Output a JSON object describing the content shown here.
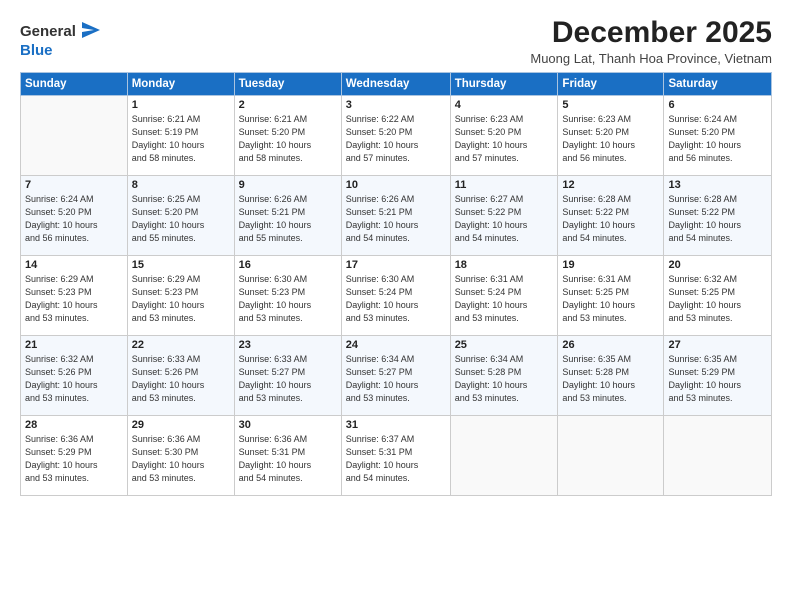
{
  "logo": {
    "general": "General",
    "blue": "Blue"
  },
  "header": {
    "month_year": "December 2025",
    "location": "Muong Lat, Thanh Hoa Province, Vietnam"
  },
  "days_of_week": [
    "Sunday",
    "Monday",
    "Tuesday",
    "Wednesday",
    "Thursday",
    "Friday",
    "Saturday"
  ],
  "weeks": [
    [
      {
        "day": "",
        "info": ""
      },
      {
        "day": "1",
        "info": "Sunrise: 6:21 AM\nSunset: 5:19 PM\nDaylight: 10 hours\nand 58 minutes."
      },
      {
        "day": "2",
        "info": "Sunrise: 6:21 AM\nSunset: 5:20 PM\nDaylight: 10 hours\nand 58 minutes."
      },
      {
        "day": "3",
        "info": "Sunrise: 6:22 AM\nSunset: 5:20 PM\nDaylight: 10 hours\nand 57 minutes."
      },
      {
        "day": "4",
        "info": "Sunrise: 6:23 AM\nSunset: 5:20 PM\nDaylight: 10 hours\nand 57 minutes."
      },
      {
        "day": "5",
        "info": "Sunrise: 6:23 AM\nSunset: 5:20 PM\nDaylight: 10 hours\nand 56 minutes."
      },
      {
        "day": "6",
        "info": "Sunrise: 6:24 AM\nSunset: 5:20 PM\nDaylight: 10 hours\nand 56 minutes."
      }
    ],
    [
      {
        "day": "7",
        "info": "Sunrise: 6:24 AM\nSunset: 5:20 PM\nDaylight: 10 hours\nand 56 minutes."
      },
      {
        "day": "8",
        "info": "Sunrise: 6:25 AM\nSunset: 5:20 PM\nDaylight: 10 hours\nand 55 minutes."
      },
      {
        "day": "9",
        "info": "Sunrise: 6:26 AM\nSunset: 5:21 PM\nDaylight: 10 hours\nand 55 minutes."
      },
      {
        "day": "10",
        "info": "Sunrise: 6:26 AM\nSunset: 5:21 PM\nDaylight: 10 hours\nand 54 minutes."
      },
      {
        "day": "11",
        "info": "Sunrise: 6:27 AM\nSunset: 5:22 PM\nDaylight: 10 hours\nand 54 minutes."
      },
      {
        "day": "12",
        "info": "Sunrise: 6:28 AM\nSunset: 5:22 PM\nDaylight: 10 hours\nand 54 minutes."
      },
      {
        "day": "13",
        "info": "Sunrise: 6:28 AM\nSunset: 5:22 PM\nDaylight: 10 hours\nand 54 minutes."
      }
    ],
    [
      {
        "day": "14",
        "info": "Sunrise: 6:29 AM\nSunset: 5:23 PM\nDaylight: 10 hours\nand 53 minutes."
      },
      {
        "day": "15",
        "info": "Sunrise: 6:29 AM\nSunset: 5:23 PM\nDaylight: 10 hours\nand 53 minutes."
      },
      {
        "day": "16",
        "info": "Sunrise: 6:30 AM\nSunset: 5:23 PM\nDaylight: 10 hours\nand 53 minutes."
      },
      {
        "day": "17",
        "info": "Sunrise: 6:30 AM\nSunset: 5:24 PM\nDaylight: 10 hours\nand 53 minutes."
      },
      {
        "day": "18",
        "info": "Sunrise: 6:31 AM\nSunset: 5:24 PM\nDaylight: 10 hours\nand 53 minutes."
      },
      {
        "day": "19",
        "info": "Sunrise: 6:31 AM\nSunset: 5:25 PM\nDaylight: 10 hours\nand 53 minutes."
      },
      {
        "day": "20",
        "info": "Sunrise: 6:32 AM\nSunset: 5:25 PM\nDaylight: 10 hours\nand 53 minutes."
      }
    ],
    [
      {
        "day": "21",
        "info": "Sunrise: 6:32 AM\nSunset: 5:26 PM\nDaylight: 10 hours\nand 53 minutes."
      },
      {
        "day": "22",
        "info": "Sunrise: 6:33 AM\nSunset: 5:26 PM\nDaylight: 10 hours\nand 53 minutes."
      },
      {
        "day": "23",
        "info": "Sunrise: 6:33 AM\nSunset: 5:27 PM\nDaylight: 10 hours\nand 53 minutes."
      },
      {
        "day": "24",
        "info": "Sunrise: 6:34 AM\nSunset: 5:27 PM\nDaylight: 10 hours\nand 53 minutes."
      },
      {
        "day": "25",
        "info": "Sunrise: 6:34 AM\nSunset: 5:28 PM\nDaylight: 10 hours\nand 53 minutes."
      },
      {
        "day": "26",
        "info": "Sunrise: 6:35 AM\nSunset: 5:28 PM\nDaylight: 10 hours\nand 53 minutes."
      },
      {
        "day": "27",
        "info": "Sunrise: 6:35 AM\nSunset: 5:29 PM\nDaylight: 10 hours\nand 53 minutes."
      }
    ],
    [
      {
        "day": "28",
        "info": "Sunrise: 6:36 AM\nSunset: 5:29 PM\nDaylight: 10 hours\nand 53 minutes."
      },
      {
        "day": "29",
        "info": "Sunrise: 6:36 AM\nSunset: 5:30 PM\nDaylight: 10 hours\nand 53 minutes."
      },
      {
        "day": "30",
        "info": "Sunrise: 6:36 AM\nSunset: 5:31 PM\nDaylight: 10 hours\nand 54 minutes."
      },
      {
        "day": "31",
        "info": "Sunrise: 6:37 AM\nSunset: 5:31 PM\nDaylight: 10 hours\nand 54 minutes."
      },
      {
        "day": "",
        "info": ""
      },
      {
        "day": "",
        "info": ""
      },
      {
        "day": "",
        "info": ""
      }
    ]
  ]
}
